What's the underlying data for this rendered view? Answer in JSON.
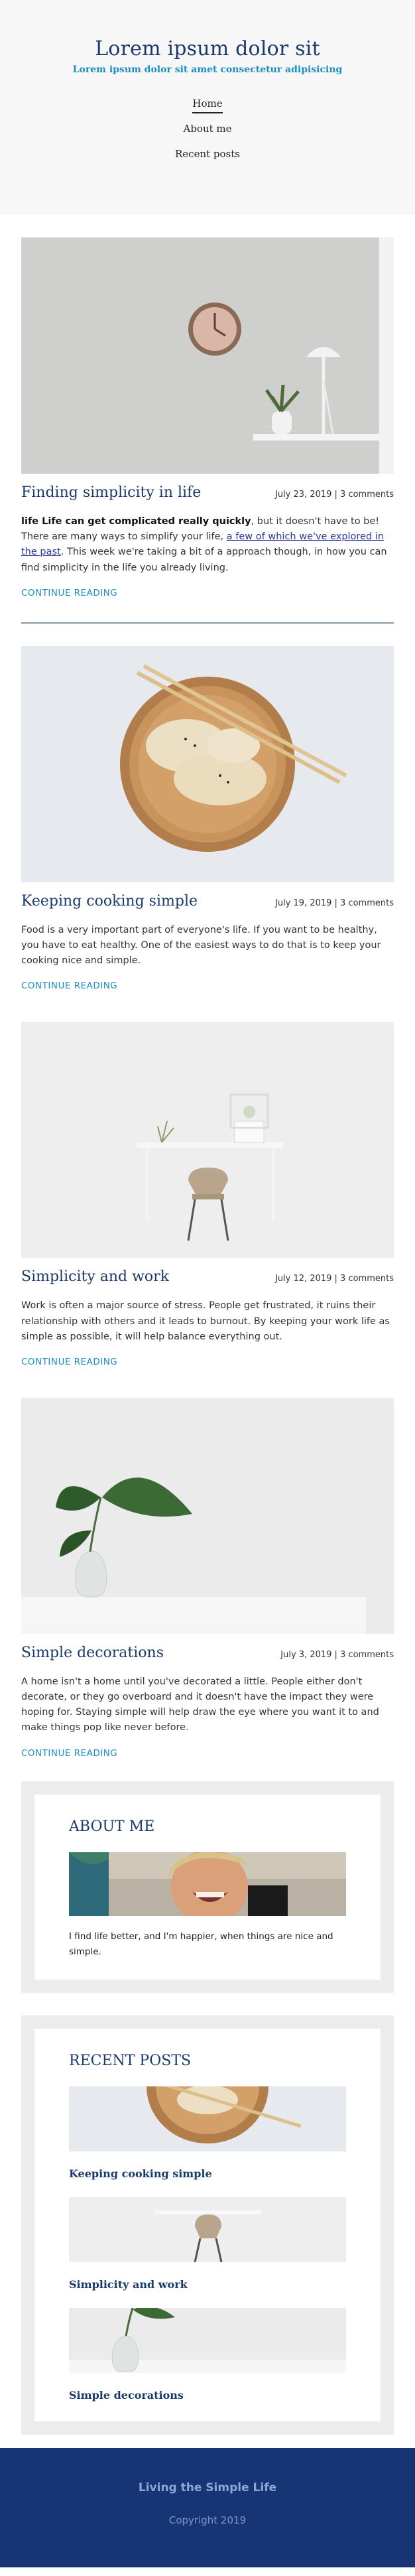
{
  "header": {
    "title": "Lorem ipsum dolor sit",
    "tagline": "Lorem ipsum dolor sit amet consectetur adipisicing",
    "nav": [
      {
        "label": "Home",
        "active": true
      },
      {
        "label": "About me",
        "active": false
      },
      {
        "label": "Recent posts",
        "active": false
      }
    ]
  },
  "posts": [
    {
      "title": "Finding simplicity in life",
      "meta": "July 23, 2019 | 3 comments",
      "excerpt_bold": "life Life can get complicated really quickly",
      "excerpt_pre": ", but it doesn't have to be! There are many ways to simplify your life, ",
      "excerpt_link": "a few of which we've explored in the past",
      "excerpt_post": ". This week we're taking a bit of a approach though, in how you can find simplicity in the life you already living.",
      "read_more": "CONTINUE READING"
    },
    {
      "title": "Keeping cooking simple",
      "meta": "July 19, 2019 | 3 comments",
      "excerpt": "Food is a very important part of everyone's life. If you want to be healthy, you have to eat healthy. One of the easiest ways to do that is to keep your cooking nice and simple.",
      "read_more": "CONTINUE READING"
    },
    {
      "title": "Simplicity and work",
      "meta": "July 12, 2019 | 3 comments",
      "excerpt": "Work is often a major source of stress. People get frustrated, it ruins their relationship with others and it leads to burnout. By keeping your work life as simple as possible, it will help balance everything out.",
      "read_more": "CONTINUE READING"
    },
    {
      "title": "Simple decorations",
      "meta": "July 3, 2019 | 3 comments",
      "excerpt": "A home isn't a home until you've decorated a little. People either don't decorate, or they go overboard and it doesn't have the impact they were hoping for. Staying simple will help draw the eye where you want it to and make things pop like never before.",
      "read_more": "CONTINUE READING"
    }
  ],
  "about": {
    "title": "ABOUT ME",
    "text": "I find life better, and I'm happier, when things are nice and simple."
  },
  "recent": {
    "title": "RECENT POSTS",
    "items": [
      {
        "title": "Keeping cooking simple"
      },
      {
        "title": "Simplicity and work"
      },
      {
        "title": "Simple decorations"
      }
    ]
  },
  "footer": {
    "title": "Living the Simple Life",
    "copyright": "Copyright 2019"
  },
  "colors": {
    "brand_navy": "#1b3a6b",
    "accent_blue": "#1b8ec0",
    "footer_bg": "#173474"
  }
}
